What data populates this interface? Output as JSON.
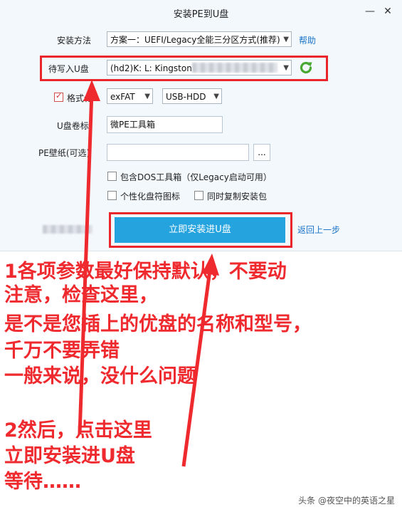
{
  "window": {
    "title": "安装PE到U盘",
    "minimize": "—",
    "close": "✕"
  },
  "form": {
    "install_method_label": "安装方法",
    "install_method_value": "方案一：UEFI/Legacy全能三分区方式(推荐)",
    "help_link": "帮助",
    "target_drive_label": "待写入U盘",
    "target_drive_value": "(hd2)K: L: Kingston",
    "format_label": "格式化",
    "format_fs_value": "exFAT",
    "boot_mode_value": "USB-HDD",
    "volume_label_label": "U盘卷标",
    "volume_label_value": "微PE工具箱",
    "wallpaper_label": "PE壁纸(可选)",
    "wallpaper_value": "",
    "browse_button": "...",
    "include_dos": "包含DOS工具箱（仅Legacy启动可用）",
    "custom_icon": "个性化盘符图标",
    "copy_installer": "同时复制安装包",
    "install_button": "立即安装进U盘",
    "back_link": "返回上一步"
  },
  "annotations": {
    "lines_group1": [
      "1各项参数最好保持默认，不要动",
      "注意，检查这里，",
      "是不是您插上的优盘的名称和型号，",
      "千万不要弄错",
      "一般来说，没什么问题"
    ],
    "lines_group2": [
      "2然后，点击这里",
      "立即安装进U盘",
      "等待……"
    ]
  },
  "watermark": "头条 @夜空中的英语之星",
  "colors": {
    "annotation_red": "#ef2a2f",
    "button_blue": "#25a3df",
    "refresh_green": "#49a832"
  }
}
